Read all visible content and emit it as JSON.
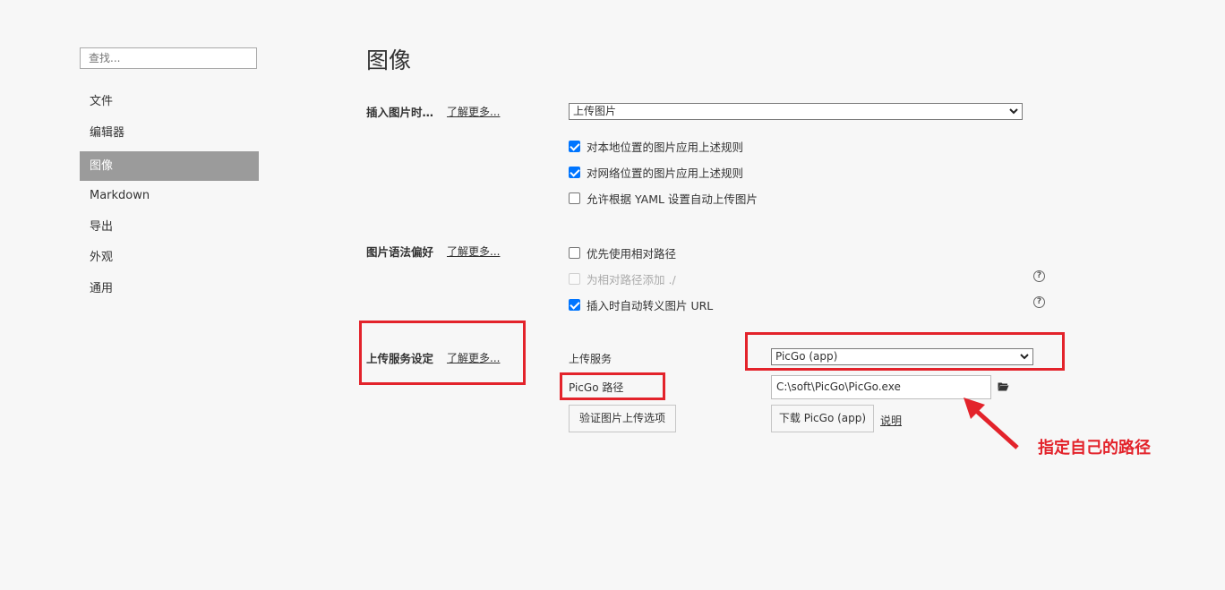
{
  "sidebar": {
    "search_placeholder": "查找...",
    "items": [
      {
        "label": "文件"
      },
      {
        "label": "编辑器"
      },
      {
        "label": "图像"
      },
      {
        "label": "Markdown"
      },
      {
        "label": "导出"
      },
      {
        "label": "外观"
      },
      {
        "label": "通用"
      }
    ]
  },
  "page": {
    "title": "图像"
  },
  "insert_section": {
    "label": "插入图片时…",
    "learn_more": "了解更多...",
    "select_value": "上传图片",
    "options": [
      {
        "label": "对本地位置的图片应用上述规则",
        "checked": true
      },
      {
        "label": "对网络位置的图片应用上述规则",
        "checked": true
      },
      {
        "label": "允许根据 YAML 设置自动上传图片",
        "checked": false
      }
    ]
  },
  "syntax_section": {
    "label": "图片语法偏好",
    "learn_more": "了解更多...",
    "options": [
      {
        "label": "优先使用相对路径",
        "checked": false
      },
      {
        "label": "为相对路径添加 ./",
        "checked": false,
        "disabled": true
      },
      {
        "label": "插入时自动转义图片 URL",
        "checked": true
      }
    ]
  },
  "upload_section": {
    "label": "上传服务设定",
    "learn_more": "了解更多...",
    "service_label": "上传服务",
    "service_value": "PicGo (app)",
    "path_label": "PicGo 路径",
    "path_value": "C:\\soft\\PicGo\\PicGo.exe",
    "verify_button": "验证图片上传选项",
    "download_button": "下载 PicGo (app)",
    "explain_link": "说明"
  },
  "annotation": {
    "text": "指定自己的路径",
    "color": "#e3232b"
  }
}
